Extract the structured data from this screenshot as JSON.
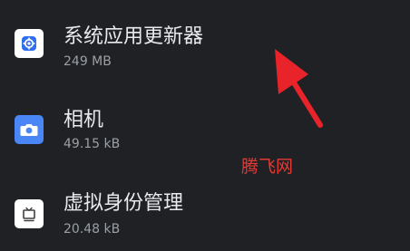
{
  "apps": [
    {
      "name": "系统应用更新器",
      "size": "249 MB",
      "icon": "gear-icon",
      "icon_color": "#2f6fed"
    },
    {
      "name": "相机",
      "size": "49.15 kB",
      "icon": "camera-icon",
      "icon_color": "#4a86f5"
    },
    {
      "name": "虚拟身份管理",
      "size": "20.48 kB",
      "icon": "tv-icon",
      "icon_color": "#ffffff"
    }
  ],
  "watermark": "腾飞网",
  "arrow_color": "#e8242a",
  "colors": {
    "background": "#202124",
    "primary_text": "#e8eaed",
    "secondary_text": "#9aa0a6"
  }
}
